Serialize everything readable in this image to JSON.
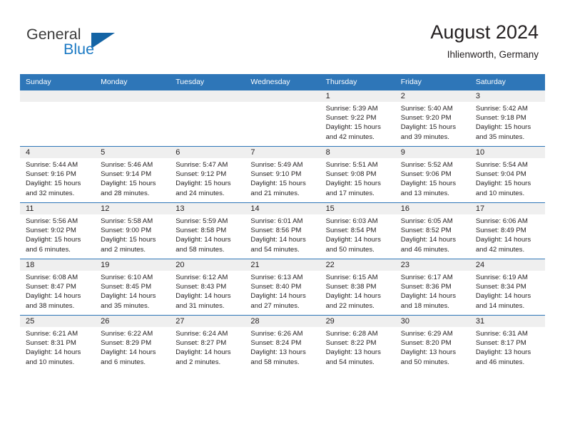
{
  "brand": {
    "name_part1": "General",
    "name_part2": "Blue",
    "triangle_color": "#1464a5",
    "blue_color": "#1c7ac4"
  },
  "header": {
    "title": "August 2024",
    "subtitle": "Ihlienworth, Germany"
  },
  "theme": {
    "header_bar_color": "#2e76b8",
    "date_band_color": "#efefef",
    "text_color": "#231f20"
  },
  "weekday_headers": [
    "Sunday",
    "Monday",
    "Tuesday",
    "Wednesday",
    "Thursday",
    "Friday",
    "Saturday"
  ],
  "weeks": [
    [
      {
        "date": "",
        "lines": []
      },
      {
        "date": "",
        "lines": []
      },
      {
        "date": "",
        "lines": []
      },
      {
        "date": "",
        "lines": []
      },
      {
        "date": "1",
        "lines": [
          "Sunrise: 5:39 AM",
          "Sunset: 9:22 PM",
          "Daylight: 15 hours",
          "and 42 minutes."
        ]
      },
      {
        "date": "2",
        "lines": [
          "Sunrise: 5:40 AM",
          "Sunset: 9:20 PM",
          "Daylight: 15 hours",
          "and 39 minutes."
        ]
      },
      {
        "date": "3",
        "lines": [
          "Sunrise: 5:42 AM",
          "Sunset: 9:18 PM",
          "Daylight: 15 hours",
          "and 35 minutes."
        ]
      }
    ],
    [
      {
        "date": "4",
        "lines": [
          "Sunrise: 5:44 AM",
          "Sunset: 9:16 PM",
          "Daylight: 15 hours",
          "and 32 minutes."
        ]
      },
      {
        "date": "5",
        "lines": [
          "Sunrise: 5:46 AM",
          "Sunset: 9:14 PM",
          "Daylight: 15 hours",
          "and 28 minutes."
        ]
      },
      {
        "date": "6",
        "lines": [
          "Sunrise: 5:47 AM",
          "Sunset: 9:12 PM",
          "Daylight: 15 hours",
          "and 24 minutes."
        ]
      },
      {
        "date": "7",
        "lines": [
          "Sunrise: 5:49 AM",
          "Sunset: 9:10 PM",
          "Daylight: 15 hours",
          "and 21 minutes."
        ]
      },
      {
        "date": "8",
        "lines": [
          "Sunrise: 5:51 AM",
          "Sunset: 9:08 PM",
          "Daylight: 15 hours",
          "and 17 minutes."
        ]
      },
      {
        "date": "9",
        "lines": [
          "Sunrise: 5:52 AM",
          "Sunset: 9:06 PM",
          "Daylight: 15 hours",
          "and 13 minutes."
        ]
      },
      {
        "date": "10",
        "lines": [
          "Sunrise: 5:54 AM",
          "Sunset: 9:04 PM",
          "Daylight: 15 hours",
          "and 10 minutes."
        ]
      }
    ],
    [
      {
        "date": "11",
        "lines": [
          "Sunrise: 5:56 AM",
          "Sunset: 9:02 PM",
          "Daylight: 15 hours",
          "and 6 minutes."
        ]
      },
      {
        "date": "12",
        "lines": [
          "Sunrise: 5:58 AM",
          "Sunset: 9:00 PM",
          "Daylight: 15 hours",
          "and 2 minutes."
        ]
      },
      {
        "date": "13",
        "lines": [
          "Sunrise: 5:59 AM",
          "Sunset: 8:58 PM",
          "Daylight: 14 hours",
          "and 58 minutes."
        ]
      },
      {
        "date": "14",
        "lines": [
          "Sunrise: 6:01 AM",
          "Sunset: 8:56 PM",
          "Daylight: 14 hours",
          "and 54 minutes."
        ]
      },
      {
        "date": "15",
        "lines": [
          "Sunrise: 6:03 AM",
          "Sunset: 8:54 PM",
          "Daylight: 14 hours",
          "and 50 minutes."
        ]
      },
      {
        "date": "16",
        "lines": [
          "Sunrise: 6:05 AM",
          "Sunset: 8:52 PM",
          "Daylight: 14 hours",
          "and 46 minutes."
        ]
      },
      {
        "date": "17",
        "lines": [
          "Sunrise: 6:06 AM",
          "Sunset: 8:49 PM",
          "Daylight: 14 hours",
          "and 42 minutes."
        ]
      }
    ],
    [
      {
        "date": "18",
        "lines": [
          "Sunrise: 6:08 AM",
          "Sunset: 8:47 PM",
          "Daylight: 14 hours",
          "and 38 minutes."
        ]
      },
      {
        "date": "19",
        "lines": [
          "Sunrise: 6:10 AM",
          "Sunset: 8:45 PM",
          "Daylight: 14 hours",
          "and 35 minutes."
        ]
      },
      {
        "date": "20",
        "lines": [
          "Sunrise: 6:12 AM",
          "Sunset: 8:43 PM",
          "Daylight: 14 hours",
          "and 31 minutes."
        ]
      },
      {
        "date": "21",
        "lines": [
          "Sunrise: 6:13 AM",
          "Sunset: 8:40 PM",
          "Daylight: 14 hours",
          "and 27 minutes."
        ]
      },
      {
        "date": "22",
        "lines": [
          "Sunrise: 6:15 AM",
          "Sunset: 8:38 PM",
          "Daylight: 14 hours",
          "and 22 minutes."
        ]
      },
      {
        "date": "23",
        "lines": [
          "Sunrise: 6:17 AM",
          "Sunset: 8:36 PM",
          "Daylight: 14 hours",
          "and 18 minutes."
        ]
      },
      {
        "date": "24",
        "lines": [
          "Sunrise: 6:19 AM",
          "Sunset: 8:34 PM",
          "Daylight: 14 hours",
          "and 14 minutes."
        ]
      }
    ],
    [
      {
        "date": "25",
        "lines": [
          "Sunrise: 6:21 AM",
          "Sunset: 8:31 PM",
          "Daylight: 14 hours",
          "and 10 minutes."
        ]
      },
      {
        "date": "26",
        "lines": [
          "Sunrise: 6:22 AM",
          "Sunset: 8:29 PM",
          "Daylight: 14 hours",
          "and 6 minutes."
        ]
      },
      {
        "date": "27",
        "lines": [
          "Sunrise: 6:24 AM",
          "Sunset: 8:27 PM",
          "Daylight: 14 hours",
          "and 2 minutes."
        ]
      },
      {
        "date": "28",
        "lines": [
          "Sunrise: 6:26 AM",
          "Sunset: 8:24 PM",
          "Daylight: 13 hours",
          "and 58 minutes."
        ]
      },
      {
        "date": "29",
        "lines": [
          "Sunrise: 6:28 AM",
          "Sunset: 8:22 PM",
          "Daylight: 13 hours",
          "and 54 minutes."
        ]
      },
      {
        "date": "30",
        "lines": [
          "Sunrise: 6:29 AM",
          "Sunset: 8:20 PM",
          "Daylight: 13 hours",
          "and 50 minutes."
        ]
      },
      {
        "date": "31",
        "lines": [
          "Sunrise: 6:31 AM",
          "Sunset: 8:17 PM",
          "Daylight: 13 hours",
          "and 46 minutes."
        ]
      }
    ]
  ]
}
